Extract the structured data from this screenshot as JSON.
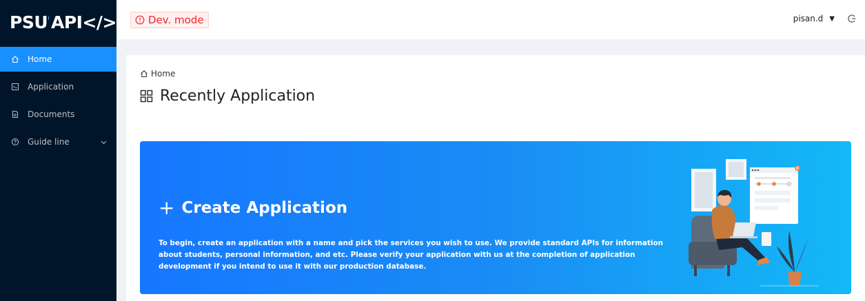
{
  "logo": {
    "text_left": "PSU",
    "text_right": "API</>"
  },
  "sidebar": {
    "items": [
      {
        "label": "Home",
        "icon": "home-icon",
        "active": true
      },
      {
        "label": "Application",
        "icon": "code-icon",
        "active": false
      },
      {
        "label": "Documents",
        "icon": "document-icon",
        "active": false
      },
      {
        "label": "Guide line",
        "icon": "question-icon",
        "active": false,
        "expandable": true
      }
    ]
  },
  "header": {
    "dev_badge": "Dev. mode",
    "user_name": "pisan.d"
  },
  "breadcrumb": {
    "label": "Home"
  },
  "page": {
    "title": "Recently Application"
  },
  "card": {
    "title": "Create Application",
    "description": "To begin, create an application with a name and pick the services you wish to use. We provide standard APIs for information about students, personal information, and etc. Please verify your application with us at the completion of application development if you intend to use it with our production database."
  },
  "colors": {
    "sidebar_bg": "#001529",
    "menu_active": "#1890ff",
    "dev_red": "#f5222d",
    "card_gradient_start": "#1677ff",
    "card_gradient_end": "#13b9f7"
  }
}
